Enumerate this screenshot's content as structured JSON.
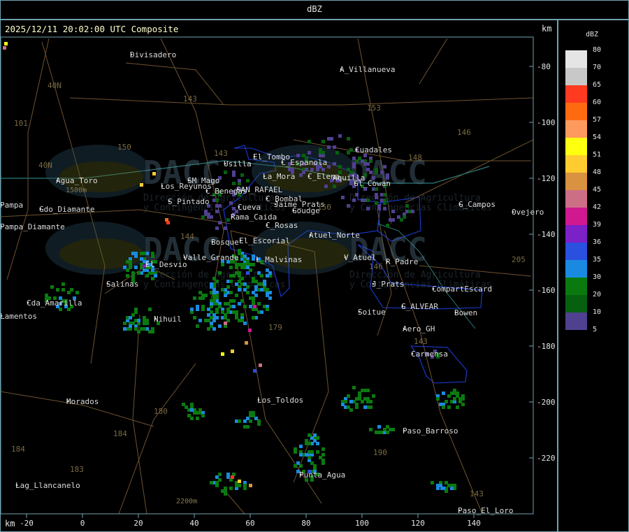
{
  "header": {
    "title": "dBZ"
  },
  "map": {
    "timestamp": "2025/12/11 20:02:00 UTC Composite",
    "unit_top": "km",
    "unit_bottom": "km",
    "y_ticks": [
      "-80",
      "-100",
      "-120",
      "-140",
      "-160",
      "-180",
      "-200",
      "-220"
    ],
    "x_ticks": [
      "-20",
      "0",
      "20",
      "40",
      "60",
      "80",
      "100",
      "120",
      "140"
    ],
    "places": [
      "Divisadero",
      "A_Villanueva",
      "El_Tombo",
      "Usilla",
      "C_Espanola",
      "La_Mora",
      "C_Elena",
      "Aquilla",
      "Cuadales",
      "Gl_Cowan",
      "Agua_Toro",
      "Los_Reyunos",
      "SM_Mago",
      "C_Benegas",
      "SAN_RAFAEL",
      "C_Bombal",
      "Goudge",
      "Jaime_Prats",
      "Cueva",
      "S_Pintado",
      "Rama_Caida",
      "C_Rosas",
      "El_Escorial",
      "Atuel_Norte",
      "Pampa_Diamante",
      "Valle_Grande",
      "L_Malvinas",
      "El_Desvio",
      "V_Atuel",
      "R_Padre",
      "G_Campos",
      "Salinas",
      "J_Prats",
      "CompartEscard",
      "Cda_Amarilla",
      "G_ALVEAR",
      "Soitue",
      "Bowen",
      "Nihuil",
      "Aero_GH",
      "Carmensa",
      "Morados",
      "Los_Toldos",
      "Paso_Barroso",
      "Punta_Agua",
      "Lag_Llancanelo",
      "Paso_El_Loro",
      "Ovejero",
      "Gdo_Diamante",
      "Pampa",
      "Lamentos",
      "Bosque"
    ],
    "route_labels": [
      "143",
      "153",
      "146",
      "148",
      "150",
      "101",
      "40N",
      "40N",
      "144",
      "143",
      "179",
      "180",
      "184",
      "183",
      "184",
      "190",
      "143",
      "143",
      "205",
      "150",
      "146"
    ],
    "watermark": {
      "brand": "DACC",
      "subtitle_lines": [
        "Dirección de Agricultura",
        "y Contingencias Climáticas"
      ]
    },
    "elevations": [
      "1500m",
      "2200m"
    ]
  },
  "legend": {
    "unit": "dBZ",
    "levels": [
      {
        "value": "80",
        "color": "#e5e5e5"
      },
      {
        "value": "70",
        "color": "#c8c8c8"
      },
      {
        "value": "65",
        "color": "#ff3a20"
      },
      {
        "value": "60",
        "color": "#ff6a10"
      },
      {
        "value": "57",
        "color": "#ff9a5e"
      },
      {
        "value": "54",
        "color": "#ffff10"
      },
      {
        "value": "51",
        "color": "#ffcc30"
      },
      {
        "value": "48",
        "color": "#d89240"
      },
      {
        "value": "45",
        "color": "#cc6e86"
      },
      {
        "value": "42",
        "color": "#d01890"
      },
      {
        "value": "39",
        "color": "#7c20c8"
      },
      {
        "value": "36",
        "color": "#2a50e0"
      },
      {
        "value": "35",
        "color": "#1a8ae0"
      },
      {
        "value": "30",
        "color": "#0a7a10"
      },
      {
        "value": "20",
        "color": "#066010"
      },
      {
        "value": "10",
        "color": "#504090"
      }
    ],
    "bottom_value": "5"
  }
}
